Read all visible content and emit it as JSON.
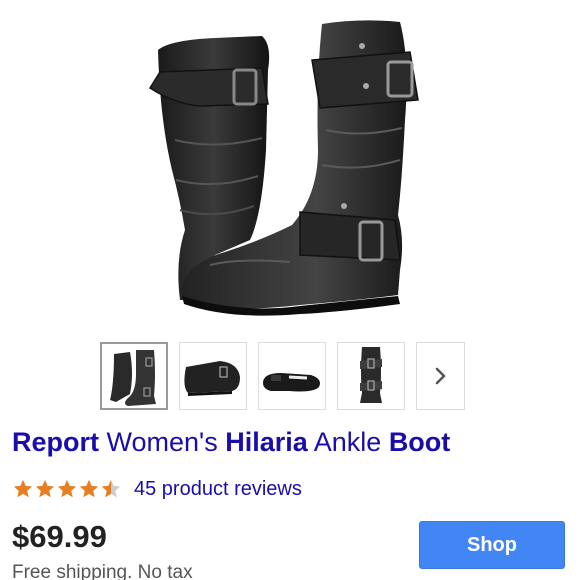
{
  "product": {
    "title_parts": [
      {
        "text": "Report",
        "bold": true
      },
      {
        "text": " Women's ",
        "bold": false
      },
      {
        "text": "Hilaria",
        "bold": true
      },
      {
        "text": " Ankle ",
        "bold": false
      },
      {
        "text": "Boot",
        "bold": true
      }
    ],
    "rating": 4.5,
    "rating_max": 5,
    "reviews_label": "45 product reviews",
    "price": "$69.99",
    "shipping": "Free shipping. No tax",
    "shop_label": "Shop"
  },
  "images": {
    "hero_icon": "boots-image",
    "thumbnails": [
      {
        "name": "boots-pair-thumbnail",
        "selected": true
      },
      {
        "name": "boot-side-thumbnail",
        "selected": false
      },
      {
        "name": "boot-sole-thumbnail",
        "selected": false
      },
      {
        "name": "boot-back-thumbnail",
        "selected": false
      }
    ],
    "next_icon": "chevron-right-icon"
  },
  "colors": {
    "link": "#1a0dab",
    "star": "#e67e22",
    "shop_button": "#4285f4"
  }
}
